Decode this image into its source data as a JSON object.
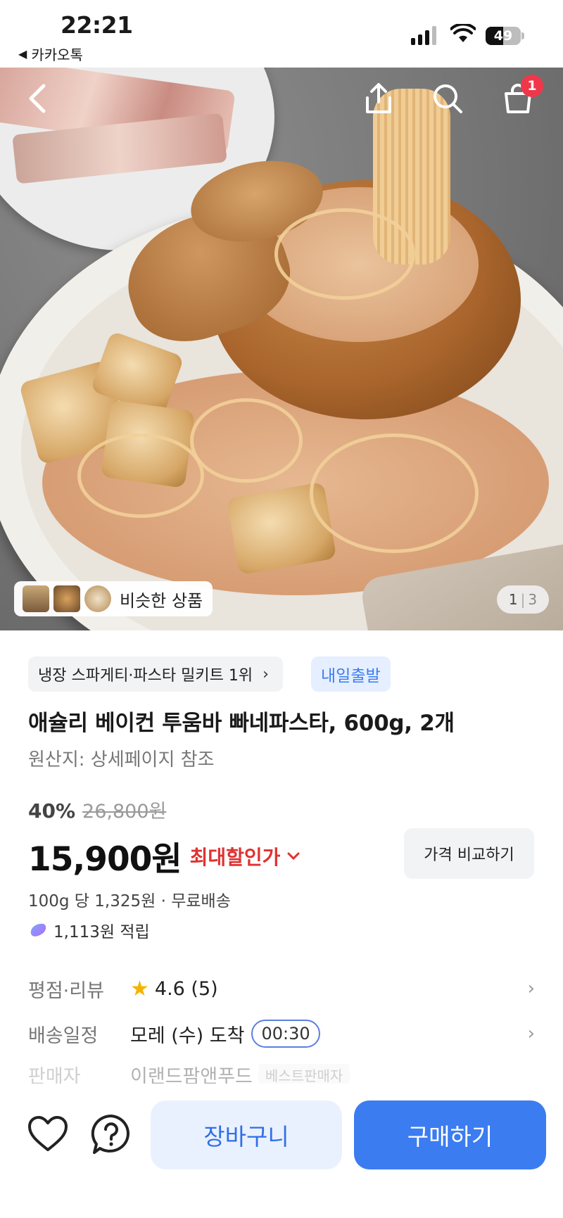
{
  "status_bar": {
    "time": "22:21",
    "back_app": "카카오톡",
    "battery": "49",
    "battery_level": 0.49
  },
  "hero": {
    "similar_label": "비슷한 상품",
    "page_current": "1",
    "page_total": "3",
    "cart_count": "1"
  },
  "product": {
    "rank_chip": "냉장 스파게티·파스타 밀키트 1위",
    "delivery_chip": "내일출발",
    "title": "애슐리 베이컨 투움바 빠네파스타, 600g, 2개",
    "origin": "원산지: 상세페이지 참조",
    "discount_pct": "40%",
    "original_price": "26,800원",
    "price": "15,900원",
    "best_price_label": "최대할인가",
    "compare_label": "가격 비교하기",
    "unit_price": "100g 당 1,325원 · 무료배송",
    "points": "1,113원 적립"
  },
  "info_rows": {
    "rating_key": "평점·리뷰",
    "rating_value": "4.6 (5)",
    "rating": 4.6,
    "shipping_key": "배송일정",
    "shipping_value": "모레 (수) 도착",
    "shipping_time": "00:30",
    "seller_key": "판매자",
    "seller_value": "이랜드팜앤푸드",
    "seller_badge": "베스트판매자"
  },
  "bottom_bar": {
    "cart_label": "장바구니",
    "buy_label": "구매하기"
  },
  "colors": {
    "primary": "#3b7cf0",
    "primary_light": "#eaf1fe",
    "discount_red": "#e03131",
    "badge_red": "#f0374a",
    "star": "#f5b301"
  }
}
